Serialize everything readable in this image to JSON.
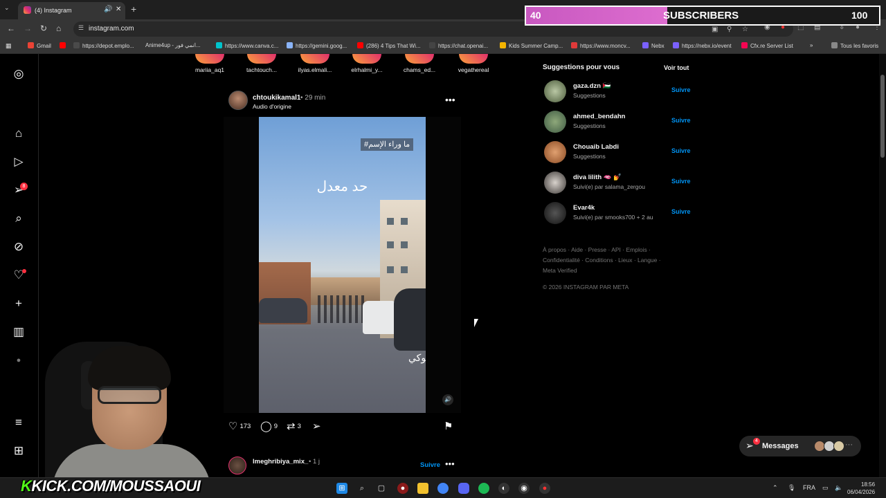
{
  "browser": {
    "tab_title": "(4) Instagram",
    "url": "instagram.com",
    "bookmarks": [
      {
        "label": "Gmail",
        "color": "#ea4335"
      },
      {
        "label": "",
        "color": "#ff0000"
      },
      {
        "label": "https://depot.emplo...",
        "color": "#4a4a4a"
      },
      {
        "label": "Anime4up - انمي فور...",
        "color": "#4a4a4a"
      },
      {
        "label": "https://www.canva.c...",
        "color": "#00c4cc"
      },
      {
        "label": "https://gemini.goog...",
        "color": "#8ab4f8"
      },
      {
        "label": "(286) 4 Tips That Wi...",
        "color": "#ff0000"
      },
      {
        "label": "https://chat.openai...",
        "color": "#444"
      },
      {
        "label": "Kids Summer Camp...",
        "color": "#f4b400"
      },
      {
        "label": "https://www.moncv...",
        "color": "#e03a3a"
      },
      {
        "label": "Nebx",
        "color": "#7b61ff"
      },
      {
        "label": "https://nebx.io/event",
        "color": "#7b61ff"
      },
      {
        "label": "Cfx.re Server List",
        "color": "#f40552"
      },
      {
        "label": "Tous les favoris",
        "color": "#888"
      }
    ]
  },
  "rail": {
    "reels_badge": "8"
  },
  "stories": [
    "mariia_aq1",
    "tachtouch...",
    "ilyas.elmali...",
    "elrhalmi_y...",
    "chams_ed...",
    "vegathereal"
  ],
  "post": {
    "username": "chtoukikamal1",
    "time": "• 29 min",
    "audio": "Audio d'origine",
    "overlay_tag": "#ما وراء الإسم",
    "overlay_text": "حد معدل",
    "corner_text": "توكي",
    "likes": "173",
    "comments": "9",
    "reposts": "3"
  },
  "post2": {
    "username": "lmeghribiya_mix_",
    "time": "• 1 j",
    "follow": "Suivre"
  },
  "suggestions": {
    "title": "Suggestions pour vous",
    "see_all": "Voir tout",
    "follow_label": "Suivre",
    "items": [
      {
        "name": "gaza.dzn 🇵🇸",
        "sub": "Suggestions"
      },
      {
        "name": "ahmed_bendahn",
        "sub": "Suggestions"
      },
      {
        "name": "Chouaib Labdi",
        "sub": "Suggestions"
      },
      {
        "name": "diva lilith 🫦 💅",
        "sub": "Suivi(e) par salama_zergou"
      },
      {
        "name": "Evar4k",
        "sub": "Suivi(e) par smooks700 + 2 au"
      }
    ],
    "footer": "À propos · Aide · Presse · API · Emplois · Confidentialité · Conditions · Lieux · Langue · Meta Verified",
    "copyright": "© 2026 INSTAGRAM PAR META"
  },
  "messages": {
    "label": "Messages",
    "badge": "4"
  },
  "overlay": {
    "sub_current": "40",
    "sub_label": "SUBSCRIBERS",
    "sub_goal": "100",
    "sub_progress": 0.4,
    "channel_prefix": "K",
    "channel": "KICK.COM/MOUSSAOUI"
  },
  "taskbar": {
    "lang": "FRA",
    "time": "18:56",
    "date": "06/04/2026"
  }
}
